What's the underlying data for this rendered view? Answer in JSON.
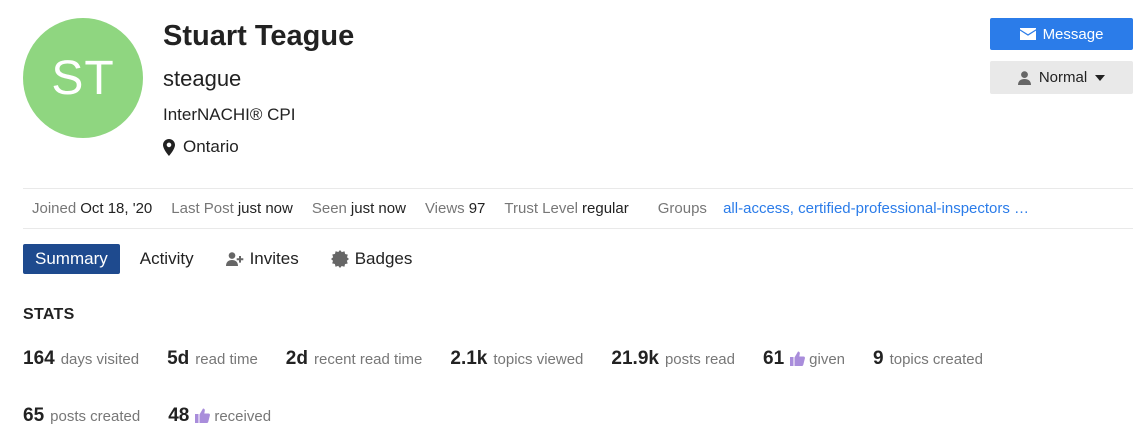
{
  "profile": {
    "avatar_initials": "ST",
    "avatar_color": "#8fd680",
    "name": "Stuart Teague",
    "username": "steague",
    "title": "InterNACHI® CPI",
    "location": "Ontario"
  },
  "actions": {
    "message_label": "Message",
    "notification_label": "Normal"
  },
  "meta": {
    "joined_label": "Joined",
    "joined_value": "Oct 18, '20",
    "last_post_label": "Last Post",
    "last_post_value": "just now",
    "seen_label": "Seen",
    "seen_value": "just now",
    "views_label": "Views",
    "views_value": "97",
    "trust_label": "Trust Level",
    "trust_value": "regular",
    "groups_label": "Groups",
    "groups": [
      "all-access,",
      "certified-professional-inspectors …"
    ]
  },
  "tabs": [
    {
      "label": "Summary",
      "active": true,
      "icon": ""
    },
    {
      "label": "Activity",
      "active": false,
      "icon": ""
    },
    {
      "label": "Invites",
      "active": false,
      "icon": "user-plus-icon"
    },
    {
      "label": "Badges",
      "active": false,
      "icon": "certificate-icon"
    }
  ],
  "stats": {
    "title": "STATS",
    "items": [
      {
        "value": "164",
        "label": "days visited"
      },
      {
        "value": "5d",
        "label": "read time"
      },
      {
        "value": "2d",
        "label": "recent read time"
      },
      {
        "value": "2.1k",
        "label": "topics viewed"
      },
      {
        "value": "21.9k",
        "label": "posts read"
      },
      {
        "value": "61",
        "label": "given",
        "icon": "thumbs-up-icon"
      },
      {
        "value": "9",
        "label": "topics created"
      },
      {
        "value": "65",
        "label": "posts created"
      },
      {
        "value": "48",
        "label": "received",
        "icon": "thumbs-up-icon"
      }
    ]
  },
  "colors": {
    "accent": "#2b7ce9",
    "active_tab": "#1e4a8e",
    "like": "#a98ddb"
  }
}
